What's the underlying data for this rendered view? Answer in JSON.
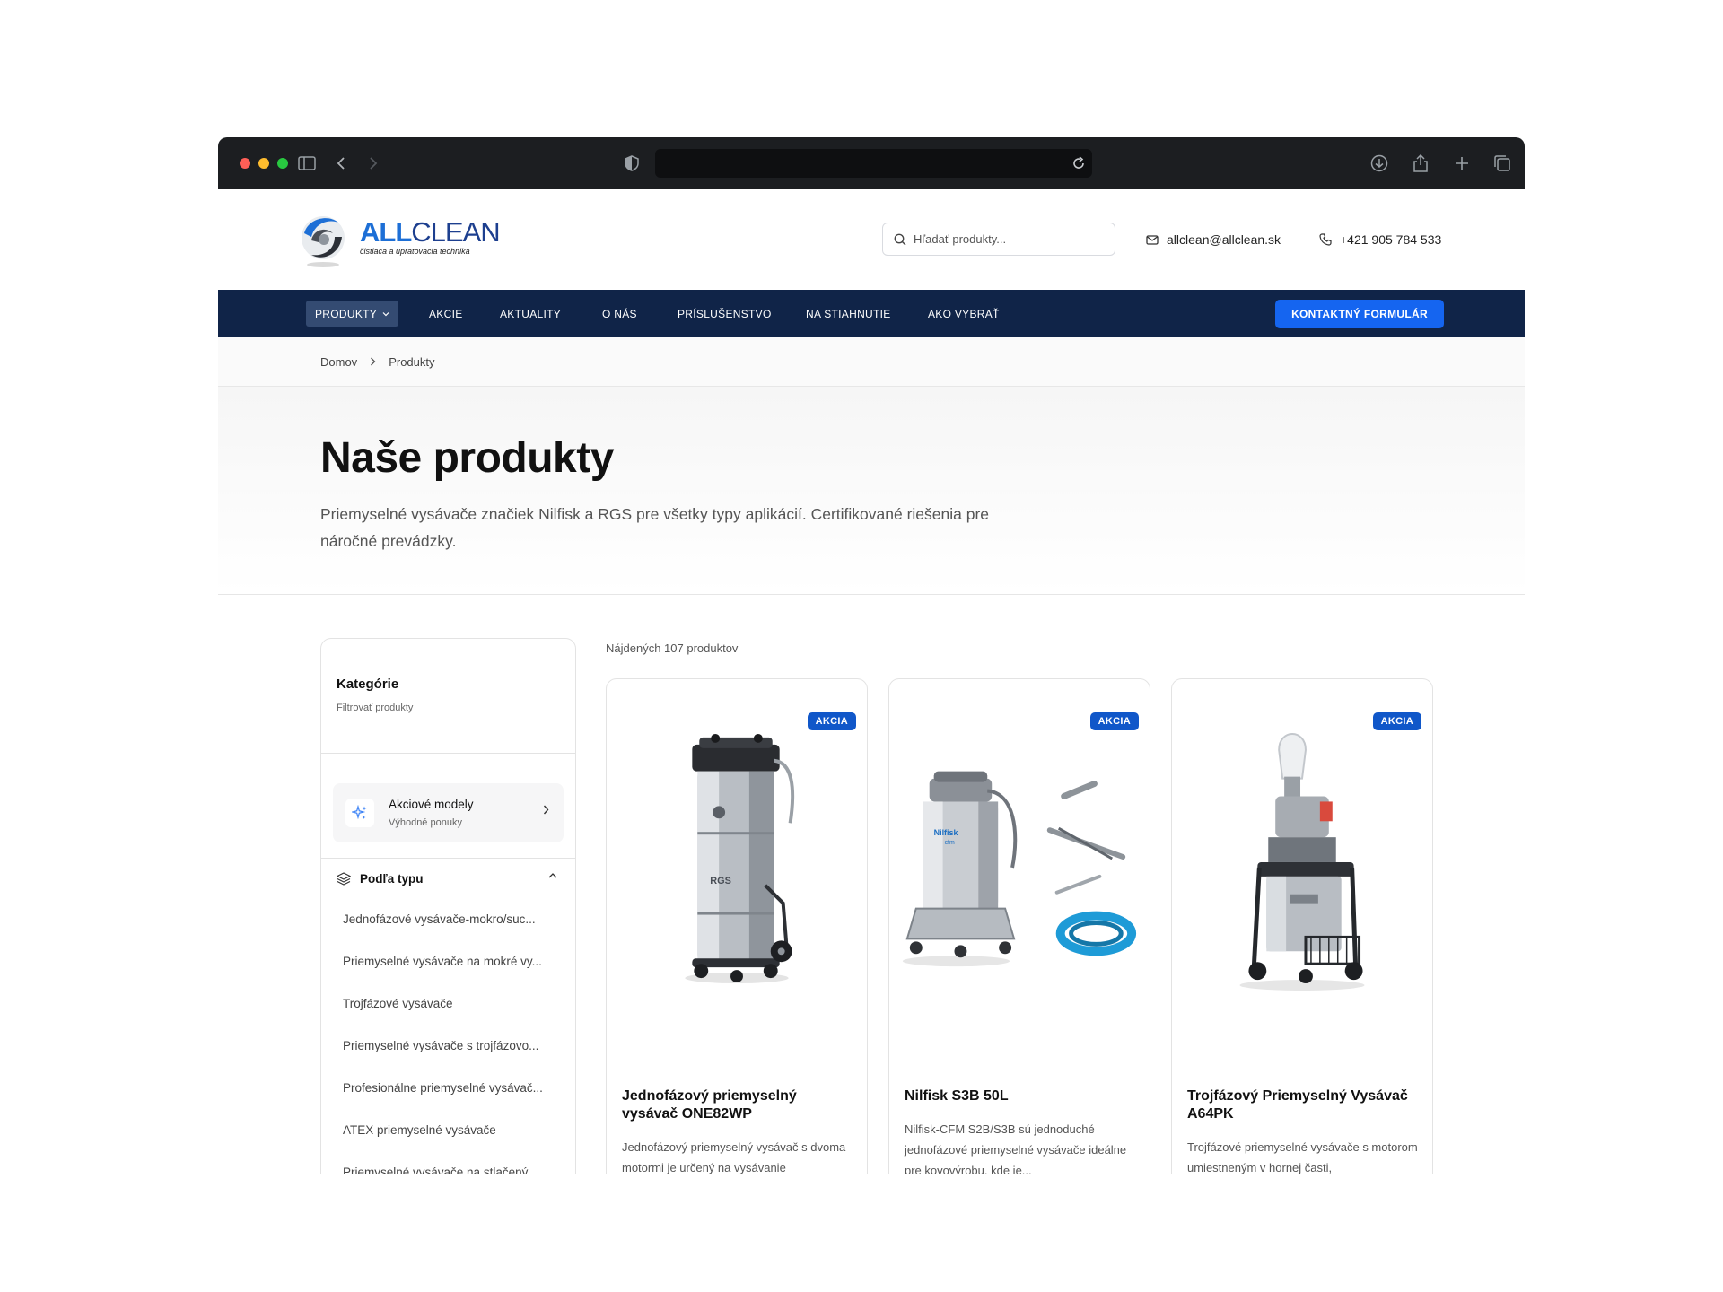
{
  "browser": {
    "address": ""
  },
  "header": {
    "logo_all": "ALL",
    "logo_clean": "CLEAN",
    "logo_tagline": "čistiaca a upratovacia technika",
    "search_placeholder": "Hľadať produkty...",
    "email": "allclean@allclean.sk",
    "phone": "+421 905 784 533"
  },
  "nav": {
    "items": [
      "PRODUKTY",
      "AKCIE",
      "AKTUALITY",
      "O NÁS",
      "PRÍSLUŠENSTVO",
      "NA STIAHNUTIE",
      "AKO VYBRAŤ"
    ],
    "cta": "KONTAKTNÝ FORMULÁR"
  },
  "breadcrumb": {
    "home": "Domov",
    "current": "Produkty"
  },
  "hero": {
    "title": "Naše produkty",
    "description": "Priemyselné vysávače značiek Nilfisk a RGS pre všetky typy aplikácií. Certifikované riešenia pre náročné prevádzky."
  },
  "sidebar": {
    "title": "Kategórie",
    "subtitle": "Filtrovať produkty",
    "promo_title": "Akciové modely",
    "promo_subtitle": "Výhodné ponuky",
    "type_heading": "Podľa typu",
    "types": [
      "Jednofázové vysávače-mokro/suc...",
      "Priemyselné vysávače na mokré vy...",
      "Trojfázové vysávače",
      "Priemyselné vysávače s trojfázovo...",
      "Profesionálne priemyselné vysávač...",
      "ATEX priemyselné vysávače",
      "Priemyselné vysávače na stlačený ..."
    ]
  },
  "results": {
    "count_text": "Nájdených 107 produktov"
  },
  "products": [
    {
      "badge": "AKCIA",
      "title": "Jednofázový priemyselný vysávač ONE82WP",
      "description": "Jednofázový priemyselný vysávač s dvoma motormi je určený na vysávanie"
    },
    {
      "badge": "AKCIA",
      "title": "Nilfisk S3B 50L",
      "description": "Nilfisk-CFM S2B/S3B sú jednoduché jednofázové priemyselné vysávače ideálne pre kovovýrobu, kde je..."
    },
    {
      "badge": "AKCIA",
      "title": "Trojfázový Priemyselný Vysávač A64PK",
      "description": "Trojfázové priemyselné vysávače s motorom umiestneným v hornej časti,"
    }
  ],
  "colors": {
    "nav_bg": "#102448",
    "cta": "#1565f0",
    "badge": "#1057c9",
    "brand_blue": "#1d6fd6"
  }
}
